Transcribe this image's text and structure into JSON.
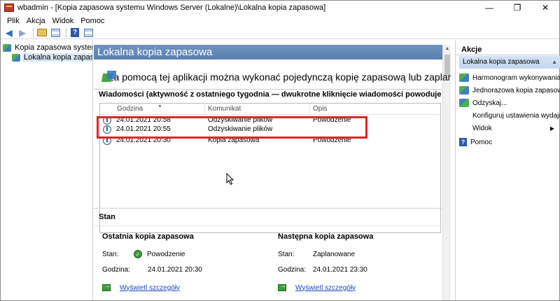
{
  "window": {
    "title": "wbadmin - [Kopia zapasowa systemu Windows Server (Lokalne)\\Lokalna kopia zapasowa]",
    "minimize": "—",
    "maximize": "❐",
    "close": "✕"
  },
  "menu": [
    "Plik",
    "Akcja",
    "Widok",
    "Pomoc"
  ],
  "toolbar": {
    "back_icon": "arrow-left-icon",
    "forward_icon": "arrow-right-icon",
    "up_icon": "folder-up-icon",
    "view_icon": "grid-view-icon",
    "help_icon": "help-icon",
    "help_glyph": "?"
  },
  "tree": {
    "root": "Kopia zapasowa systemu Windows Server (Lokalne)",
    "child": "Lokalna kopia zapasowa"
  },
  "center": {
    "header": "Lokalna kopia zapasowa",
    "intro": "Za pomocą tej aplikacji można wykonać pojedynczą kopię zapasową lub zaplanować c",
    "messages_heading": "Wiadomości (aktywność z ostatniego tygodnia — dwukrotne kliknięcie wiadomości powoduje wyświetlenie szczegółów)",
    "columns": [
      "Godzina",
      "Komunikat",
      "Opis"
    ],
    "rows": [
      {
        "time": "24.01.2021 20:58",
        "message": "Odzyskiwanie plików",
        "status": "Powodzenie"
      },
      {
        "time": "24.01.2021 20:55",
        "message": "Odzyskiwanie plików",
        "status": ""
      },
      {
        "time": "24.01.2021 20:30",
        "message": "Kopia zapasowa",
        "status": "Powodzenie"
      }
    ],
    "info_glyph": "i",
    "stan_title": "Stan",
    "last": {
      "heading": "Ostatnia kopia zapasowa",
      "stan_label": "Stan:",
      "stan_value": "Powodzenie",
      "time_label": "Godzina:",
      "time_value": "24.01.2021 20:30",
      "link": "Wyświetl szczegóły"
    },
    "next": {
      "heading": "Następna kopia zapasowa",
      "stan_label": "Stan:",
      "stan_value": "Zaplanowane",
      "time_label": "Godzina:",
      "time_value": "24.01.2021 23:30",
      "link": "Wyświetl szczegóły"
    }
  },
  "actions": {
    "title": "Akcje",
    "section": "Lokalna kopia zapasowa",
    "items": [
      "Harmonogram wykonywania kopii zapasowej...",
      "Jednorazowa kopia zapasowa...",
      "Odzyskaj...",
      "Konfiguruj ustawienia wydajności...",
      "Widok",
      "Pomoc"
    ]
  },
  "colors": {
    "header_blue": "#5a7fb0",
    "highlight_red": "#e0242c",
    "link_blue": "#1a46c8",
    "selection": "#c3d7ee"
  }
}
